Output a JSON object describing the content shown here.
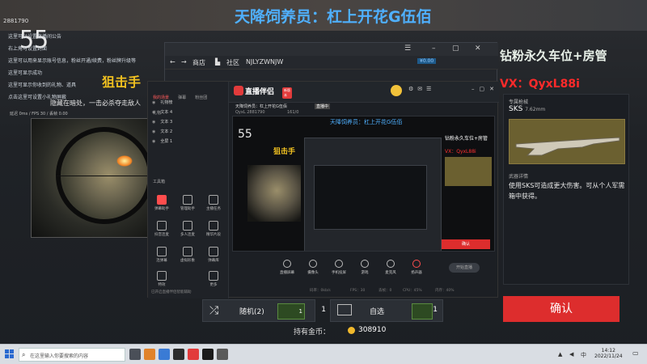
{
  "overlay": {
    "top_banner": "天降饲养员：杠上开花G伍佰",
    "corner_id": "2881790",
    "counter": "55",
    "sniper_title": "狙击手",
    "hide_text": "隐藏在暗处，一击必杀夺走敌人",
    "stat_line": "延迟 0ms / FPS 30 / 丢帧 0.00",
    "right_promo": "钻粉永久车位+房管",
    "right_vx": "VX：QyxL88i",
    "lines": [
      "这里可以设置直播间公告",
      "右上角可设置封面",
      "这里可以用来显示账号信息，粉丝开通/续费，粉丝牌升级等",
      "这里可显示成功",
      "这里可显示你收到的礼物、道具",
      "点击这里可设置小礼物屏蔽"
    ]
  },
  "weapon": {
    "tag": "专属枪械",
    "name": "SKS",
    "caliber": "7.62mm",
    "desc_title": "武器详情",
    "desc": "使用SKS可造成更大伤害。可从个人军需箱中获得。",
    "confirm": "确认"
  },
  "selection": {
    "random_label": "随机(2)",
    "random_count": "1",
    "random_badge": "1",
    "free_label": "自选",
    "free_count": "1",
    "coins_label": "持有金币：",
    "coins_value": "308910"
  },
  "app": {
    "nav_store": "商店",
    "nav_community": "社区",
    "username": "NJLYZWNJW",
    "balance": "¥0.00"
  },
  "tool": {
    "brand": "直播伴侣",
    "brand_badge": "新版本",
    "tabs": [
      "我的场景",
      "弹幕",
      "粉丝团",
      "礼物"
    ],
    "scenes": [
      "礼物榜",
      "文本 4",
      "文本 3",
      "文本 2",
      "全屏 1"
    ],
    "section_label": "工具箱",
    "items": [
      "弹幕助手",
      "管理助手",
      "主播任务",
      "抖音连麦",
      "多人连麦",
      "精华片段",
      "连弹幕",
      "虚拟形象",
      "弹幕库",
      "特效",
      "更多"
    ],
    "footer_note": "已开启直播伴侣智能辅助",
    "info_title": "天降饲养员：杠上开花G伍佰",
    "info_status": "直播中",
    "info_id": "QyxL 2881790",
    "info_viewers": "161/0",
    "toolbar": [
      "直播屏幕",
      "摄像头",
      "手机投屏",
      "游戏",
      "麦克风",
      "扬声器"
    ],
    "go_live": "开始直播",
    "status": [
      "码率：0kb/s",
      "FPS：30",
      "丢帧：0",
      "CPU：45%",
      "内存：40%"
    ]
  },
  "taskbar": {
    "search_placeholder": "在这里输入你要搜索的内容",
    "time": "14:12",
    "date": "2022/11/24"
  }
}
